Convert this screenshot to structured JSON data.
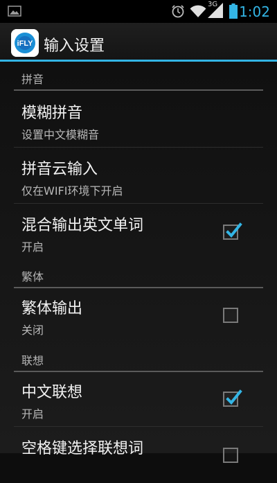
{
  "status_bar": {
    "time": "1:02",
    "network_type": "3G",
    "icons": [
      "gallery-icon",
      "alarm-icon",
      "wifi-icon",
      "signal-icon",
      "battery-icon"
    ]
  },
  "action_bar": {
    "app_icon_text": "iFLY",
    "title": "输入设置",
    "accent_color": "#33b5e5"
  },
  "sections": [
    {
      "category": "拼音"
    },
    {
      "category": "繁体"
    },
    {
      "category": "联想"
    }
  ],
  "prefs": [
    {
      "title": "模糊拼音",
      "summary": "设置中文模糊音"
    },
    {
      "title": "拼音云输入",
      "summary": "仅在WIFI环境下开启"
    },
    {
      "title": "混合输出英文单词",
      "summary": "开启",
      "checked": true
    },
    {
      "title": "繁体输出",
      "summary": "关闭",
      "checked": false
    },
    {
      "title": "中文联想",
      "summary": "开启",
      "checked": true
    },
    {
      "title": "空格键选择联想词",
      "checked": false
    }
  ]
}
